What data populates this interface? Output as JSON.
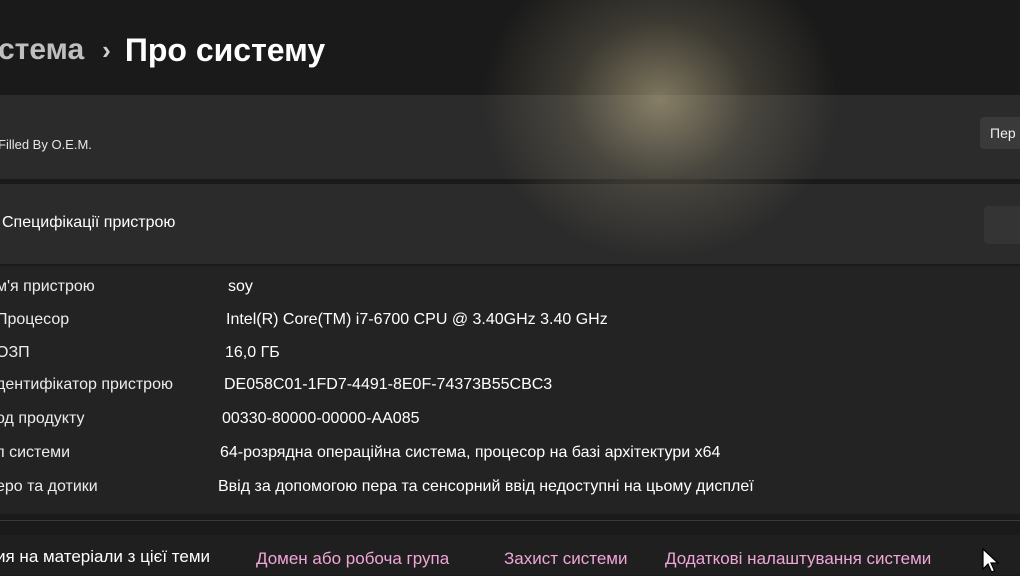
{
  "header": {
    "breadcrumb_parent": "стема",
    "breadcrumb_separator": "›",
    "page_title": "Про систему"
  },
  "device_card": {
    "oem_label": "Filled By O.E.M.",
    "rename_button_label": "Пер"
  },
  "specs_section": {
    "title": "Специфікації пристрою",
    "rows": [
      {
        "label": "м'я пристрою",
        "value": "soy"
      },
      {
        "label": "Процесор",
        "value": "Intel(R) Core(TM) i7-6700 CPU @ 3.40GHz   3.40 GHz"
      },
      {
        "label": "ОЗП",
        "value": "16,0 ГБ"
      },
      {
        "label": "дентифікатор пристрою",
        "value": "DE058C01-1FD7-4491-8E0F-74373B55CBC3"
      },
      {
        "label": "од продукту",
        "value": "00330-80000-00000-AA085"
      },
      {
        "label": "п системи",
        "value": "64-розрядна операційна система, процесор на базі архітектури x64"
      },
      {
        "label": "еро та дотики",
        "value": "Ввід за допомогою пера та сенсорний ввід недоступні на цьому дисплеї"
      }
    ]
  },
  "related_links": {
    "label": "ия на матеріали з цієї теми",
    "links": [
      "Домен або робоча група",
      "Захист системи",
      "Додаткові налаштування системи"
    ],
    "link_color": "#f0a6d6"
  },
  "icons": {
    "cursor": "mouse-pointer-icon",
    "separator": "chevron-right-icon"
  }
}
